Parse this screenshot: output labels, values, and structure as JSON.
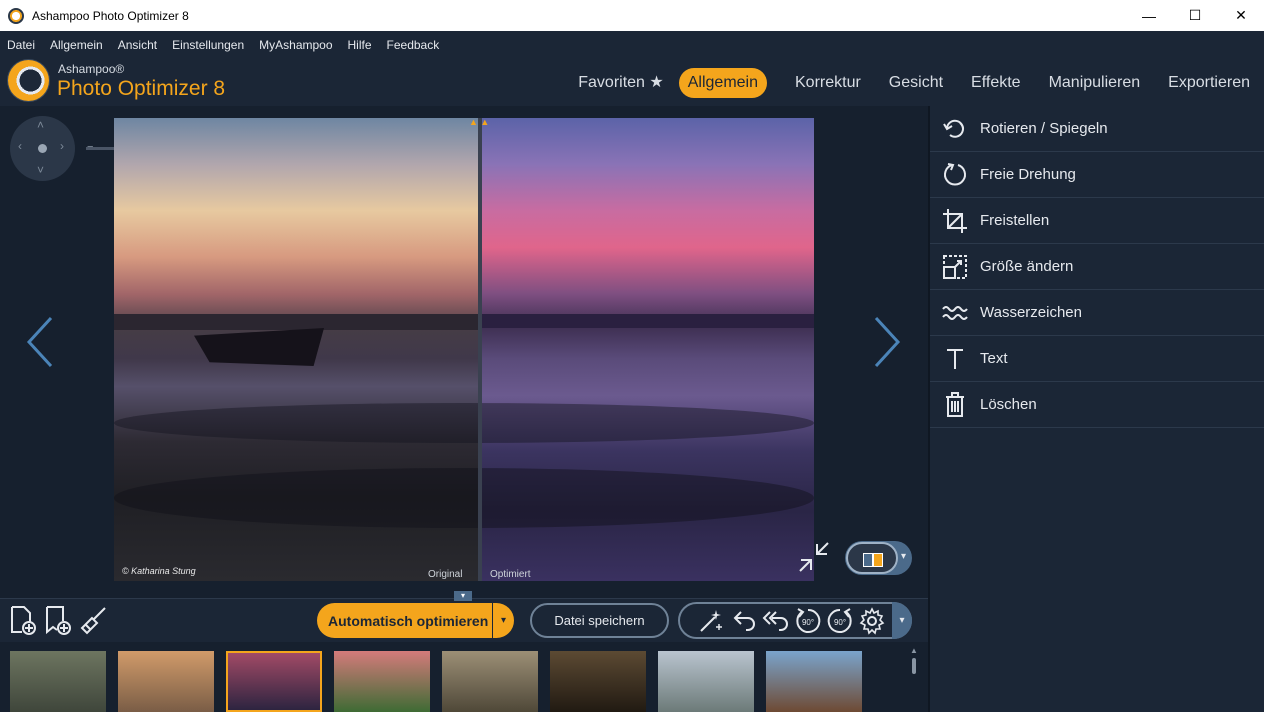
{
  "window": {
    "title": "Ashampoo Photo Optimizer 8",
    "minimize": "—",
    "maximize": "☐",
    "close": "✕"
  },
  "menu": [
    "Datei",
    "Allgemein",
    "Ansicht",
    "Einstellungen",
    "MyAshampoo",
    "Hilfe",
    "Feedback"
  ],
  "brand": {
    "small": "Ashampoo®",
    "big": "Photo Optimizer 8"
  },
  "tabs": [
    {
      "label": "Favoriten ★",
      "active": false
    },
    {
      "label": "Allgemein",
      "active": true
    },
    {
      "label": "Korrektur",
      "active": false
    },
    {
      "label": "Gesicht",
      "active": false
    },
    {
      "label": "Effekte",
      "active": false
    },
    {
      "label": "Manipulieren",
      "active": false
    },
    {
      "label": "Exportieren",
      "active": false
    }
  ],
  "zoom": {
    "minus": "−",
    "plus": "+",
    "level": 0.33
  },
  "photo": {
    "copyright": "© Katharina Stung",
    "label_original": "Original",
    "label_optimized": "Optimiert",
    "compare_marks": "▲ ▲"
  },
  "sidebar": [
    {
      "label": "Rotieren / Spiegeln",
      "icon": "rotate-icon"
    },
    {
      "label": "Freie Drehung",
      "icon": "free-rotate-icon"
    },
    {
      "label": "Freistellen",
      "icon": "crop-icon"
    },
    {
      "label": "Größe ändern",
      "icon": "resize-icon"
    },
    {
      "label": "Wasserzeichen",
      "icon": "watermark-icon"
    },
    {
      "label": "Text",
      "icon": "text-icon"
    },
    {
      "label": "Löschen",
      "icon": "trash-icon"
    }
  ],
  "toolbar": {
    "auto_optimize": "Automatisch optimieren",
    "save_file": "Datei speichern",
    "dropdown": "▾",
    "rotate_label": "90°"
  },
  "filmstrip": {
    "selected_index": 2,
    "thumbs": [
      {
        "name": "temple",
        "colors": [
          "#6d7560",
          "#3f463b"
        ]
      },
      {
        "name": "cat",
        "colors": [
          "#d19b6a",
          "#7a5d46"
        ]
      },
      {
        "name": "sunset",
        "colors": [
          "#a24a66",
          "#2d2440"
        ]
      },
      {
        "name": "egret",
        "colors": [
          "#d47b7b",
          "#3e6b34"
        ]
      },
      {
        "name": "monkey",
        "colors": [
          "#9c8f76",
          "#4f4838"
        ]
      },
      {
        "name": "pots",
        "colors": [
          "#5c4a33",
          "#211a12"
        ]
      },
      {
        "name": "coast",
        "colors": [
          "#b9c4cf",
          "#6c7a78"
        ]
      },
      {
        "name": "tree",
        "colors": [
          "#7aa4cc",
          "#6e4a33"
        ]
      }
    ]
  }
}
